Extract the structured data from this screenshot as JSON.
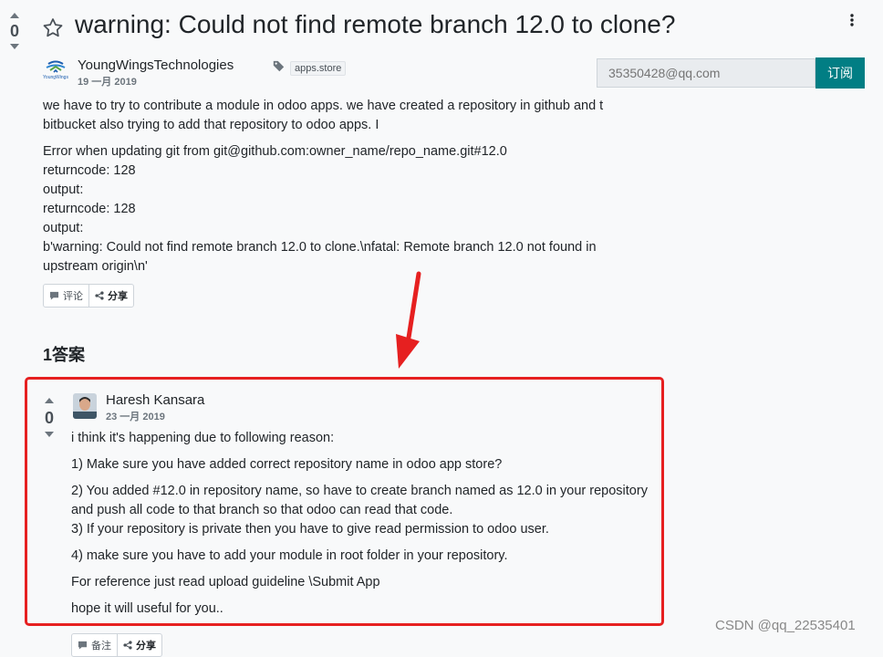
{
  "question": {
    "votes": "0",
    "title": "warning: Could not find remote branch 12.0 to clone?",
    "author": "YoungWingsTechnologies",
    "date": "19 一月 2019",
    "tag": "apps.store",
    "avatar_text": "YoungWings",
    "paragraphs": [
      "we have to try to contribute a module in odoo apps. we have created a repository in github and t",
      "bitbucket also trying to add that repository to odoo apps. I"
    ],
    "error_lines": [
      "Error when updating git from git@github.com:owner_name/repo_name.git#12.0",
      "returncode: 128",
      "output:",
      "returncode: 128",
      "output:",
      "b'warning: Could not find remote branch 12.0 to clone.\\nfatal: Remote branch 12.0 not found in",
      "upstream origin\\n'"
    ],
    "comment_label": "评论",
    "share_label": "分享"
  },
  "subscribe": {
    "placeholder": "35350428@qq.com",
    "button_label": "订阅"
  },
  "answers_heading": "1答案",
  "answer": {
    "votes": "0",
    "author": "Haresh Kansara",
    "date": "23 一月 2019",
    "lines": [
      "i think it's happening due to following reason:",
      "1) Make sure you have added correct repository name  in odoo app store?",
      "2) You added #12.0 in repository name, so have to create branch named as 12.0 in your repository",
      "and push all code to that branch so that odoo can read that code.",
      "3) If your repository is private then you have to give read permission to odoo user.",
      "4) make sure you have to add your module in root folder in your repository.",
      "For reference just read upload guideline \\Submit App",
      "hope it will useful for you.."
    ],
    "comment_label": "备注",
    "share_label": "分享"
  },
  "watermark": "CSDN @qq_22535401",
  "colors": {
    "accent": "#017e84",
    "highlight": "#e62020",
    "arrow": "#e62020"
  }
}
